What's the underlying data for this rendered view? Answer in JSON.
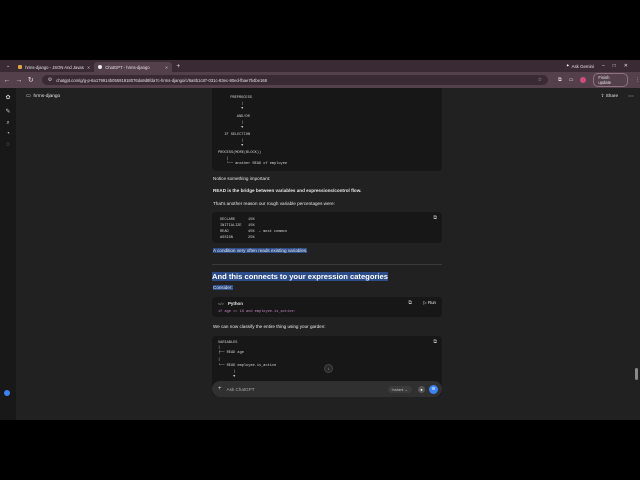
{
  "browser": {
    "tabs": [
      {
        "label": "hrms-django - JSON And Javas",
        "active": false
      },
      {
        "label": "ChatGPT - hrms-django",
        "active": true
      }
    ],
    "new_tab": "+",
    "ask_gemini": "Ask Gemini",
    "url": "chatgpt.com/g/g-p-6a179914b05591918076da9d8fda7c-hrms-django/c/6a8b1c87-031c-83ec-80ed-fbae7b4be168",
    "finish_update": "Finish update"
  },
  "header": {
    "project": "hrms-django",
    "share": "Share"
  },
  "tree_block": {
    "lines": [
      "  PREPROCESS",
      "       |",
      "       ▼",
      "     AND/OR",
      "       |",
      "       ▼",
      "  IF SELECTION",
      "       |",
      "       ▼",
      "PROCESS(MORE(BLOCK))",
      "    |",
      "    └── another READ of employee"
    ]
  },
  "text1": "Notice something important:",
  "text2_bold": "READ is the bridge between variables and expressions/control flow.",
  "text3": "That's another reason our rough variable percentages were:",
  "percent_block": {
    "lines": [
      "DECLARE      15%",
      "INITIALIZE   15%",
      "READ         45%  ← most common",
      "ASSIGN       25%"
    ]
  },
  "highlight_line": "A condition very often reads existing variables.",
  "heading": "And this connects to your expression categories",
  "consider": "Consider:",
  "python_block": {
    "lang": "Python",
    "run": "Run",
    "code": "if age >= 18 and employee.is_active:"
  },
  "text4": "We can now classify the entire thing using your garden:",
  "vars_block": {
    "lines": [
      "VARIABLES",
      "|",
      "├── READ age",
      "|",
      "└── READ employee.is_active",
      "       |",
      "       ▼"
    ]
  },
  "composer": {
    "placeholder": "Ask ChatGPT",
    "model": "Instant ⌄"
  }
}
